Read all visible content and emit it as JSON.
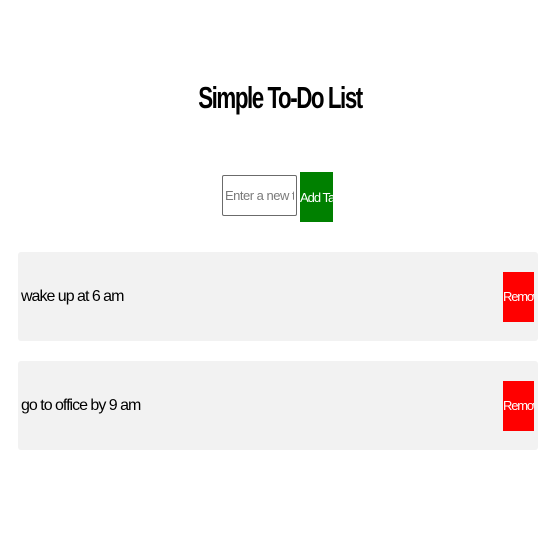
{
  "app": {
    "title": "Simple To-Do List"
  },
  "add_form": {
    "input_value": "",
    "input_placeholder": "Enter a new task",
    "add_button_label": "Add Task",
    "add_button_color": "#008000"
  },
  "tasks": [
    {
      "text": "wake up at 6 am",
      "remove_label": "Remove"
    },
    {
      "text": "go to office by 9 am",
      "remove_label": "Remove"
    }
  ],
  "colors": {
    "remove_button": "#ff0000",
    "task_background": "#f2f2f2"
  }
}
